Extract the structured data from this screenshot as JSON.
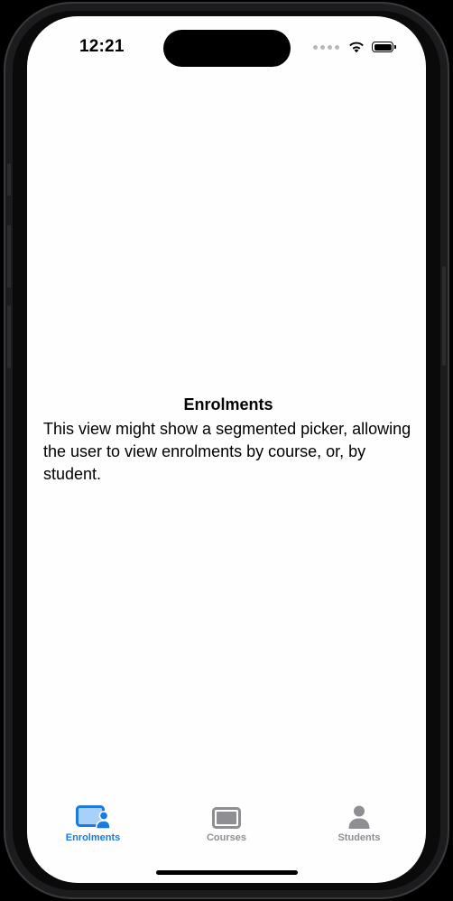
{
  "status_bar": {
    "time": "12:21"
  },
  "main": {
    "title": "Enrolments",
    "body": "This view might show a segmented picker, allowing the user to view enrolments by course, or, by student."
  },
  "tab_bar": {
    "tabs": [
      {
        "label": "Enrolments",
        "icon": "enrolments-icon",
        "active": true
      },
      {
        "label": "Courses",
        "icon": "courses-icon",
        "active": false
      },
      {
        "label": "Students",
        "icon": "person-icon",
        "active": false
      }
    ]
  },
  "colors": {
    "accent": "#1a7ae0",
    "inactive": "#8e8e93"
  }
}
